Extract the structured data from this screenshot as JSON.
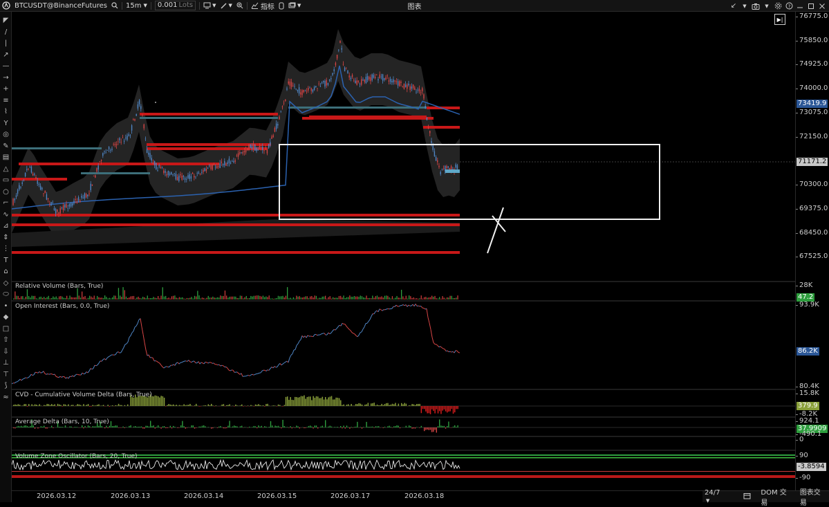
{
  "toolbar": {
    "symbol": "BTCUSDT@BinanceFutures",
    "interval": "15m",
    "quantity": "0.001",
    "quantity_unit": "Lots",
    "indicators_label": "指标",
    "center_title": "图表"
  },
  "price_axis": {
    "ticks": [
      "76775.0",
      "75850.0",
      "74925.0",
      "74000.0",
      "73075.0",
      "72150.0",
      "70300.0",
      "69375.0",
      "68450.0",
      "67525.0"
    ],
    "current_price": "71171.2",
    "tag_price": "73419.9"
  },
  "panes": {
    "relative_volume": {
      "label": "Relative Volume (Bars, True)",
      "max": "28K",
      "value": "47.2"
    },
    "open_interest": {
      "label": "Open Interest (Bars, 0.0, True)",
      "max": "93.9K",
      "value": "86.2K",
      "min": "80.4K"
    },
    "cvd": {
      "label": "CVD - Cumulative Volume Delta (Bars, True)",
      "max": "15.8K",
      "value": "379.9",
      "min": "-8.2K"
    },
    "average_delta": {
      "label": "Average Delta (Bars, 10, True)",
      "max": "924.1",
      "value": "37.9909",
      "min": "-490.1",
      "zero": "0"
    },
    "volume_zone": {
      "label": "Volume Zone Oscillator (Bars, 20, True)",
      "upper": "90",
      "value": "-3.8594",
      "lower": "-90"
    }
  },
  "dates": [
    "2026.03.12",
    "2026.03.13",
    "2026.03.14",
    "2026.03.15",
    "2026.03.17",
    "2026.03.18"
  ],
  "bottom_bar": {
    "session": "24/7",
    "dom": "DOM 交易",
    "chart_trade": "图表交易"
  },
  "colors": {
    "up": "#4f86c6",
    "down": "#d64545",
    "level_red": "#c81818",
    "level_teal": "#3d6f7a",
    "vwap": "#2b62b0",
    "tag_blue": "#2b5797",
    "tag_green": "#2e9e3e"
  },
  "icons": [
    "search-icon",
    "chevron-down-icon",
    "draw-tools-icon",
    "zoom-icon",
    "indicators-icon",
    "template-icon",
    "layout-icon",
    "camera-icon",
    "settings-icon",
    "help-icon",
    "minimize-icon",
    "maximize-icon",
    "close-icon",
    "goto-live-icon"
  ]
}
